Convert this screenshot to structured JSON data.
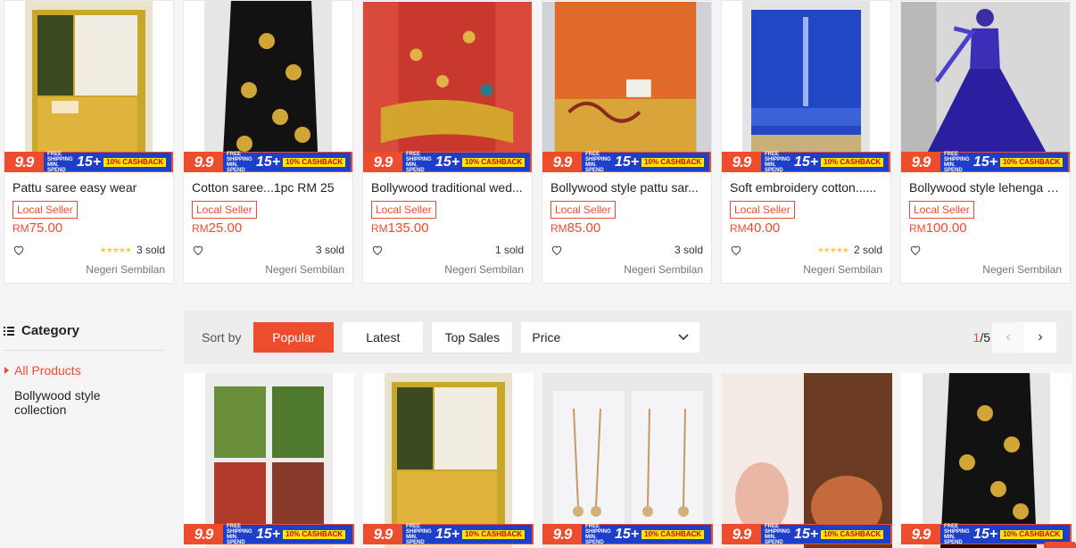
{
  "promo": {
    "nine": "9.9",
    "free_shipping": "FREE SHIPPING MIN. SPEND",
    "fifteen": "15+",
    "cashback": "10% CASHBACK"
  },
  "products": [
    {
      "title": "Pattu saree easy wear",
      "seller": "Local Seller",
      "currency": "RM",
      "price": "75.00",
      "rating_stars": 5,
      "stars_text": "★★★★★",
      "sold": "3 sold",
      "location": "Negeri Sembilan"
    },
    {
      "title": "Cotton saree...1pc RM 25",
      "seller": "Local Seller",
      "currency": "RM",
      "price": "25.00",
      "rating_stars": 0,
      "stars_text": "",
      "sold": "3 sold",
      "location": "Negeri Sembilan"
    },
    {
      "title": "Bollywood traditional wed...",
      "seller": "Local Seller",
      "currency": "RM",
      "price": "135.00",
      "rating_stars": 0,
      "stars_text": "",
      "sold": "1 sold",
      "location": "Negeri Sembilan"
    },
    {
      "title": "Bollywood style pattu sar...",
      "seller": "Local Seller",
      "currency": "RM",
      "price": "85.00",
      "rating_stars": 0,
      "stars_text": "",
      "sold": "3 sold",
      "location": "Negeri Sembilan"
    },
    {
      "title": "Soft embroidery cotton......",
      "seller": "Local Seller",
      "currency": "RM",
      "price": "40.00",
      "rating_stars": 5,
      "stars_text": "★★★★★",
      "sold": "2 sold",
      "location": "Negeri Sembilan"
    },
    {
      "title": "Bollywood style lehenga s...",
      "seller": "Local Seller",
      "currency": "RM",
      "price": "100.00",
      "rating_stars": 0,
      "stars_text": "",
      "sold": "",
      "location": "Negeri Sembilan"
    }
  ],
  "sidebar": {
    "title": "Category",
    "items": [
      {
        "label": "All Products"
      },
      {
        "label": "Bollywood style collection"
      }
    ]
  },
  "sortbar": {
    "label": "Sort by",
    "options": [
      "Popular",
      "Latest",
      "Top Sales"
    ],
    "price_label": "Price",
    "page_current": "1",
    "page_total": "/5",
    "prev": "‹",
    "next": "›"
  },
  "colors": {
    "accent": "#ee4d2d",
    "promo_blue": "#1d3fc9",
    "promo_yellow": "#ffe500"
  }
}
